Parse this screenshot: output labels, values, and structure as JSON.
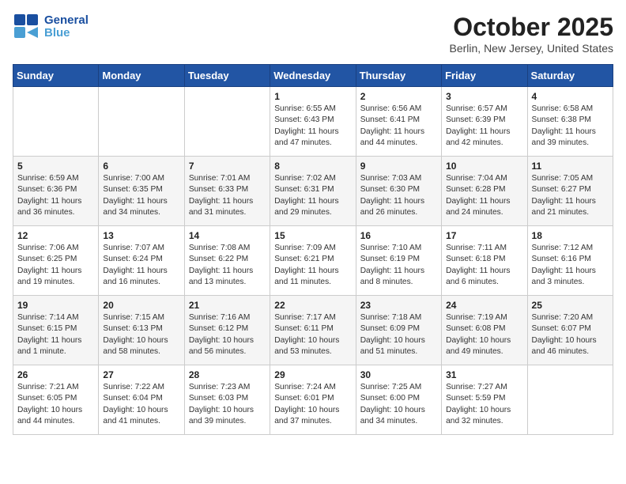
{
  "header": {
    "logo_line1": "General",
    "logo_line2": "Blue",
    "title": "October 2025",
    "subtitle": "Berlin, New Jersey, United States"
  },
  "weekdays": [
    "Sunday",
    "Monday",
    "Tuesday",
    "Wednesday",
    "Thursday",
    "Friday",
    "Saturday"
  ],
  "weeks": [
    [
      {
        "day": "",
        "detail": ""
      },
      {
        "day": "",
        "detail": ""
      },
      {
        "day": "",
        "detail": ""
      },
      {
        "day": "1",
        "detail": "Sunrise: 6:55 AM\nSunset: 6:43 PM\nDaylight: 11 hours\nand 47 minutes."
      },
      {
        "day": "2",
        "detail": "Sunrise: 6:56 AM\nSunset: 6:41 PM\nDaylight: 11 hours\nand 44 minutes."
      },
      {
        "day": "3",
        "detail": "Sunrise: 6:57 AM\nSunset: 6:39 PM\nDaylight: 11 hours\nand 42 minutes."
      },
      {
        "day": "4",
        "detail": "Sunrise: 6:58 AM\nSunset: 6:38 PM\nDaylight: 11 hours\nand 39 minutes."
      }
    ],
    [
      {
        "day": "5",
        "detail": "Sunrise: 6:59 AM\nSunset: 6:36 PM\nDaylight: 11 hours\nand 36 minutes."
      },
      {
        "day": "6",
        "detail": "Sunrise: 7:00 AM\nSunset: 6:35 PM\nDaylight: 11 hours\nand 34 minutes."
      },
      {
        "day": "7",
        "detail": "Sunrise: 7:01 AM\nSunset: 6:33 PM\nDaylight: 11 hours\nand 31 minutes."
      },
      {
        "day": "8",
        "detail": "Sunrise: 7:02 AM\nSunset: 6:31 PM\nDaylight: 11 hours\nand 29 minutes."
      },
      {
        "day": "9",
        "detail": "Sunrise: 7:03 AM\nSunset: 6:30 PM\nDaylight: 11 hours\nand 26 minutes."
      },
      {
        "day": "10",
        "detail": "Sunrise: 7:04 AM\nSunset: 6:28 PM\nDaylight: 11 hours\nand 24 minutes."
      },
      {
        "day": "11",
        "detail": "Sunrise: 7:05 AM\nSunset: 6:27 PM\nDaylight: 11 hours\nand 21 minutes."
      }
    ],
    [
      {
        "day": "12",
        "detail": "Sunrise: 7:06 AM\nSunset: 6:25 PM\nDaylight: 11 hours\nand 19 minutes."
      },
      {
        "day": "13",
        "detail": "Sunrise: 7:07 AM\nSunset: 6:24 PM\nDaylight: 11 hours\nand 16 minutes."
      },
      {
        "day": "14",
        "detail": "Sunrise: 7:08 AM\nSunset: 6:22 PM\nDaylight: 11 hours\nand 13 minutes."
      },
      {
        "day": "15",
        "detail": "Sunrise: 7:09 AM\nSunset: 6:21 PM\nDaylight: 11 hours\nand 11 minutes."
      },
      {
        "day": "16",
        "detail": "Sunrise: 7:10 AM\nSunset: 6:19 PM\nDaylight: 11 hours\nand 8 minutes."
      },
      {
        "day": "17",
        "detail": "Sunrise: 7:11 AM\nSunset: 6:18 PM\nDaylight: 11 hours\nand 6 minutes."
      },
      {
        "day": "18",
        "detail": "Sunrise: 7:12 AM\nSunset: 6:16 PM\nDaylight: 11 hours\nand 3 minutes."
      }
    ],
    [
      {
        "day": "19",
        "detail": "Sunrise: 7:14 AM\nSunset: 6:15 PM\nDaylight: 11 hours\nand 1 minute."
      },
      {
        "day": "20",
        "detail": "Sunrise: 7:15 AM\nSunset: 6:13 PM\nDaylight: 10 hours\nand 58 minutes."
      },
      {
        "day": "21",
        "detail": "Sunrise: 7:16 AM\nSunset: 6:12 PM\nDaylight: 10 hours\nand 56 minutes."
      },
      {
        "day": "22",
        "detail": "Sunrise: 7:17 AM\nSunset: 6:11 PM\nDaylight: 10 hours\nand 53 minutes."
      },
      {
        "day": "23",
        "detail": "Sunrise: 7:18 AM\nSunset: 6:09 PM\nDaylight: 10 hours\nand 51 minutes."
      },
      {
        "day": "24",
        "detail": "Sunrise: 7:19 AM\nSunset: 6:08 PM\nDaylight: 10 hours\nand 49 minutes."
      },
      {
        "day": "25",
        "detail": "Sunrise: 7:20 AM\nSunset: 6:07 PM\nDaylight: 10 hours\nand 46 minutes."
      }
    ],
    [
      {
        "day": "26",
        "detail": "Sunrise: 7:21 AM\nSunset: 6:05 PM\nDaylight: 10 hours\nand 44 minutes."
      },
      {
        "day": "27",
        "detail": "Sunrise: 7:22 AM\nSunset: 6:04 PM\nDaylight: 10 hours\nand 41 minutes."
      },
      {
        "day": "28",
        "detail": "Sunrise: 7:23 AM\nSunset: 6:03 PM\nDaylight: 10 hours\nand 39 minutes."
      },
      {
        "day": "29",
        "detail": "Sunrise: 7:24 AM\nSunset: 6:01 PM\nDaylight: 10 hours\nand 37 minutes."
      },
      {
        "day": "30",
        "detail": "Sunrise: 7:25 AM\nSunset: 6:00 PM\nDaylight: 10 hours\nand 34 minutes."
      },
      {
        "day": "31",
        "detail": "Sunrise: 7:27 AM\nSunset: 5:59 PM\nDaylight: 10 hours\nand 32 minutes."
      },
      {
        "day": "",
        "detail": ""
      }
    ]
  ]
}
